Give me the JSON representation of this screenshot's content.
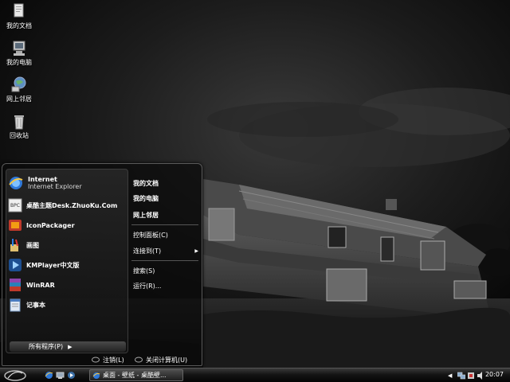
{
  "desktop": {
    "icons": [
      {
        "label": "我的文档",
        "icon": "my-documents-icon"
      },
      {
        "label": "我的电脑",
        "icon": "my-computer-icon"
      },
      {
        "label": "网上邻居",
        "icon": "network-places-icon"
      },
      {
        "label": "回收站",
        "icon": "recycle-bin-icon"
      }
    ]
  },
  "start_menu": {
    "programs": [
      {
        "name": "Internet",
        "sub": "Internet Explorer",
        "icon": "internet-explorer-icon"
      },
      {
        "name": "桌酷主题Desk.ZhuoKu.Com",
        "icon": "zhuoku-theme-icon"
      },
      {
        "name": "IconPackager",
        "icon": "iconpackager-icon"
      },
      {
        "name": "画图",
        "icon": "paint-icon"
      },
      {
        "name": "KMPlayer中文版",
        "icon": "kmplayer-icon"
      },
      {
        "name": "WinRAR",
        "icon": "winrar-icon"
      },
      {
        "name": "记事本",
        "icon": "notepad-icon"
      }
    ],
    "all_programs": "所有程序(P)",
    "right": {
      "my_documents": "我的文档",
      "my_computer": "我的电脑",
      "network": "网上邻居",
      "control_panel": "控制面板(C)",
      "connect_to": "连接到(T)",
      "search": "搜索(S)",
      "run": "运行(R)..."
    },
    "logoff": "注销(L)",
    "shutdown": "关闭计算机(U)"
  },
  "taskbar": {
    "task_button": "桌面 - 壁纸 - 桌酷壁...",
    "clock": "20:07"
  },
  "colors": {
    "taskbar_top": "#3a3a3a",
    "taskbar_bottom": "#050505",
    "menu_panel": "#1a1a1a"
  }
}
